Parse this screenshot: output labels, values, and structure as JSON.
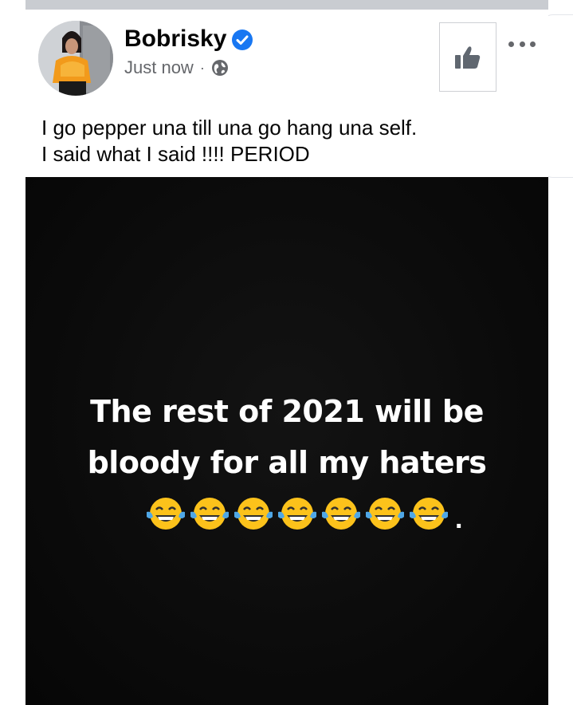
{
  "post": {
    "author": "Bobrisky",
    "timestamp": "Just now",
    "meta_separator": "·",
    "privacy_icon": "globe-icon",
    "verified_icon": "verified-badge-icon",
    "caption_line1": "I go pepper una till una go hang una self.",
    "caption_line2": "I said what I said !!!! PERIOD"
  },
  "image": {
    "line1": "The rest of 2021 will be",
    "line2": "bloody for all my haters",
    "emoji": [
      "😂",
      "😂",
      "😂",
      "😂",
      "😂",
      "😂",
      "😂"
    ],
    "trailing": "."
  },
  "actions": {
    "like_icon": "thumbs-up-icon",
    "more_icon": "more-options-icon"
  },
  "colors": {
    "verified_blue": "#1877f2",
    "meta_gray": "#65676b",
    "image_background": "#0b0b0b"
  }
}
